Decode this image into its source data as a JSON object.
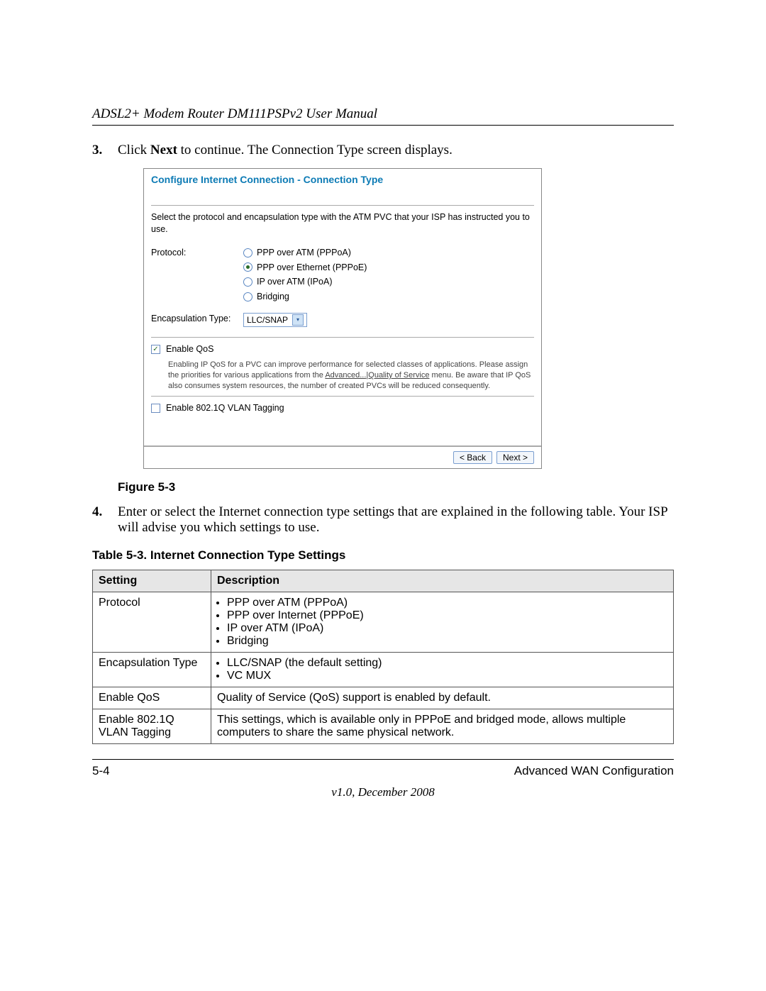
{
  "header": {
    "running_head": "ADSL2+ Modem Router DM111PSPv2 User Manual"
  },
  "step3": {
    "num": "3.",
    "text_before_bold": "Click ",
    "bold": "Next",
    "text_after_bold": " to continue. The Connection Type screen displays."
  },
  "panel": {
    "title": "Configure Internet Connection - Connection Type",
    "instructions": "Select the protocol and encapsulation type with the ATM PVC that your ISP has instructed you to use.",
    "protocol_label": "Protocol:",
    "protocol_options": [
      "PPP over ATM (PPPoA)",
      "PPP over Ethernet (PPPoE)",
      "IP over ATM (IPoA)",
      "Bridging"
    ],
    "protocol_selected_index": 1,
    "encap_label": "Encapsulation Type:",
    "encap_value": "LLC/SNAP",
    "qos_label": "Enable QoS",
    "qos_checked": true,
    "qos_note_1": "Enabling IP QoS for a PVC can improve performance for selected classes of applications. Please assign the priorities for various applications from the ",
    "qos_note_link": "Advanced...|Quality of Service",
    "qos_note_2": " menu. Be aware that IP QoS also consumes system resources, the number of created PVCs will be reduced consequently.",
    "vlan_label": "Enable 802.1Q VLAN Tagging",
    "vlan_checked": false,
    "back_btn": "< Back",
    "next_btn": "Next >"
  },
  "fig_caption": "Figure 5-3",
  "step4": {
    "num": "4.",
    "line1": "Enter or select the Internet connection type settings that are explained in the following table.",
    "line2": "Your ISP will advise you which settings to use."
  },
  "table": {
    "title": "Table 5-3. Internet Connection Type Settings",
    "headers": [
      "Setting",
      "Description"
    ],
    "rows": [
      {
        "setting": "Protocol",
        "bullets": [
          "PPP over ATM (PPPoA)",
          "PPP over Internet (PPPoE)",
          "IP over ATM (IPoA)",
          "Bridging"
        ]
      },
      {
        "setting": "Encapsulation Type",
        "bullets": [
          "LLC/SNAP (the default setting)",
          "VC MUX"
        ]
      },
      {
        "setting": "Enable QoS",
        "text": "Quality of Service (QoS) support is enabled by default."
      },
      {
        "setting": "Enable 802.1Q VLAN Tagging",
        "text": "This settings, which is available only in PPPoE and bridged mode, allows multiple computers to share the same physical network."
      }
    ]
  },
  "footer": {
    "page_num": "5-4",
    "section": "Advanced WAN Configuration",
    "version": "v1.0, December 2008"
  }
}
